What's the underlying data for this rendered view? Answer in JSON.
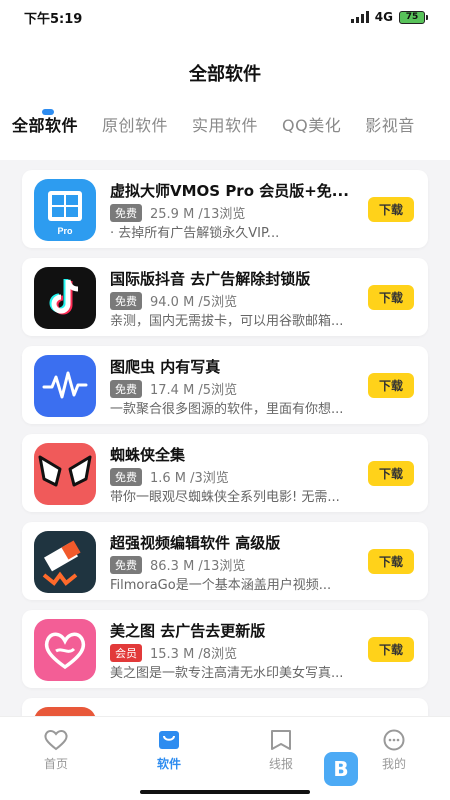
{
  "status_bar": {
    "time": "下午5:19",
    "network": "4G",
    "battery": "75"
  },
  "header": {
    "title": "全部软件"
  },
  "tabs": [
    {
      "label": "全部软件",
      "active": true
    },
    {
      "label": "原创软件"
    },
    {
      "label": "实用软件"
    },
    {
      "label": "QQ美化"
    },
    {
      "label": "影视音"
    }
  ],
  "apps": [
    {
      "name": "虚拟大师VMOS Pro 会员版+免...",
      "badge": "免费",
      "stats": "25.9 M /13浏览",
      "desc": "· 去掉所有广告解锁永久VIP...",
      "button": "下载",
      "icon": "vmos-icon"
    },
    {
      "name": "国际版抖音 去广告解除封锁版",
      "badge": "免费",
      "stats": "94.0 M /5浏览",
      "desc": "亲测，国内无需拔卡，可以用谷歌邮箱...",
      "button": "下载",
      "icon": "tiktok-icon"
    },
    {
      "name": "图爬虫 内有写真",
      "badge": "免费",
      "stats": "17.4 M /5浏览",
      "desc": "一款聚合很多图源的软件，里面有你想...",
      "button": "下载",
      "icon": "wave-icon"
    },
    {
      "name": "蜘蛛侠全集",
      "badge": "免费",
      "stats": "1.6 M /3浏览",
      "desc": "带你一眼观尽蜘蛛侠全系列电影! 无需...",
      "button": "下载",
      "icon": "spiderman-icon"
    },
    {
      "name": "超强视频编辑软件 高级版",
      "badge": "免费",
      "stats": "86.3 M /13浏览",
      "desc": "FilmoraGo是一个基本涵盖用户视频...",
      "button": "下载",
      "icon": "filmora-icon"
    },
    {
      "name": "美之图 去广告去更新版",
      "badge": "会员",
      "stats": "15.3 M /8浏览",
      "desc": "美之图是一款专注高清无水印美女写真...",
      "button": "下载",
      "icon": "heart-icon"
    }
  ],
  "bottom_nav": [
    {
      "label": "首页",
      "icon": "heart-outline-icon"
    },
    {
      "label": "软件",
      "icon": "bag-icon",
      "active": true
    },
    {
      "label": "线报",
      "icon": "bookmark-icon"
    },
    {
      "label": "我的",
      "icon": "face-icon"
    }
  ],
  "colors": {
    "accent": "#2d8cf0",
    "button": "#ffd21a",
    "vip_badge": "#e23a3a",
    "free_badge": "#7a7a7a"
  }
}
